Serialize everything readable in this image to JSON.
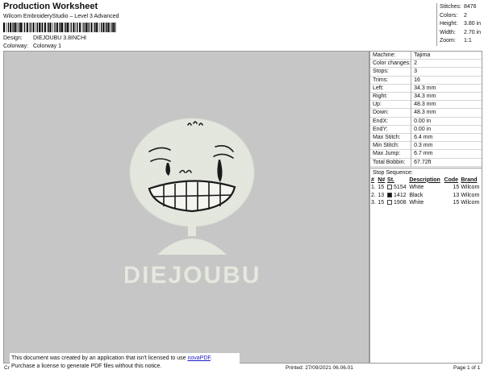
{
  "header": {
    "title": "Production Worksheet",
    "subtitle": "Wilcom EmbroideryStudio – Level 3 Advanced",
    "design_label": "Design:",
    "design_value": "DIEJOUBU 3.8INCHI",
    "colorway_label": "Colorway:",
    "colorway_value": "Colorway 1"
  },
  "summary": [
    {
      "label": "Stitches:",
      "value": "8476"
    },
    {
      "label": "Colors:",
      "value": "2"
    },
    {
      "label": "Height:",
      "value": "3.80 in"
    },
    {
      "label": "Width:",
      "value": "2.70 in"
    },
    {
      "label": "Zoom:",
      "value": "1:1"
    }
  ],
  "machine": [
    {
      "label": "Machine:",
      "value": "Tajima"
    },
    {
      "label": "Color changes:",
      "value": "2"
    },
    {
      "label": "Stops:",
      "value": "3"
    },
    {
      "label": "Trims:",
      "value": "16"
    },
    {
      "label": "Left:",
      "value": "34.3 mm"
    },
    {
      "label": "Right:",
      "value": "34.3 mm"
    },
    {
      "label": "Up:",
      "value": "48.3 mm"
    },
    {
      "label": "Down:",
      "value": "48.3 mm"
    },
    {
      "label": "EndX:",
      "value": "0.00 in"
    },
    {
      "label": "EndY:",
      "value": "0.00 in"
    },
    {
      "label": "Max Stitch:",
      "value": "6.4 mm"
    },
    {
      "label": "Min Stitch:",
      "value": "0.3 mm"
    },
    {
      "label": "Max Jump:",
      "value": "6.7 mm"
    },
    {
      "label": "Total Bobbin:",
      "value": "67.72ft"
    }
  ],
  "stop_sequence": {
    "title": "Stop Sequence:",
    "columns": [
      "#",
      "N#",
      "St.",
      "Description",
      "Code",
      "Brand"
    ],
    "rows": [
      {
        "num": "1.",
        "needle": "15",
        "color": "#ffffff",
        "stitches": "5154",
        "description": "White",
        "code": "15",
        "brand": "Wilcom"
      },
      {
        "num": "2.",
        "needle": "13",
        "color": "#111111",
        "stitches": "1412",
        "description": "Black",
        "code": "13",
        "brand": "Wilcom"
      },
      {
        "num": "3.",
        "needle": "15",
        "color": "#ffffff",
        "stitches": "1908",
        "description": "White",
        "code": "15",
        "brand": "Wilcom"
      }
    ]
  },
  "design_text": "DIEJOUBU",
  "footer": {
    "left": "Cr",
    "printed": "Printed: 27/09/2021 06.06.01",
    "page": "Page 1 of 1"
  },
  "notice": {
    "line1_prefix": "This document was created by an application that isn't licensed to use ",
    "link": "novaPDF",
    "line1_suffix": ".",
    "line2": "Purchase a license to generate PDF files without this notice."
  },
  "colors": {
    "canvas_bg": "#c6c6c6",
    "thread_white": "#e6e9e0",
    "thread_black": "#1a1a1a"
  }
}
